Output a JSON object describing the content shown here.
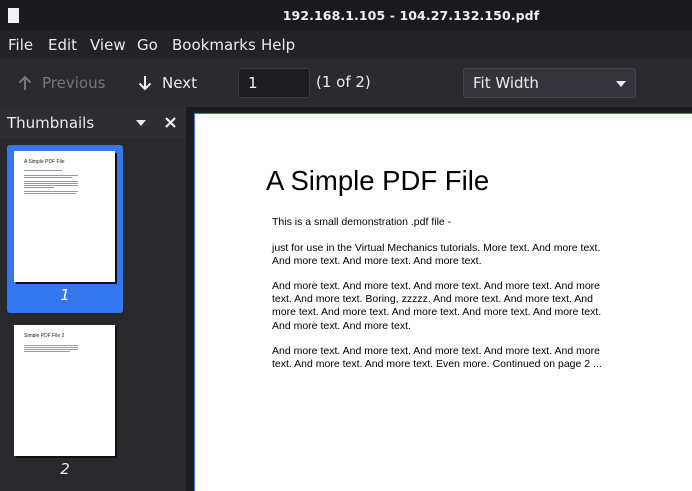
{
  "window": {
    "title": "192.168.1.105 - 104.27.132.150.pdf"
  },
  "menu": [
    "File",
    "Edit",
    "View",
    "Go",
    "Bookmarks",
    "Help"
  ],
  "toolbar": {
    "previous_label": "Previous",
    "next_label": "Next",
    "page_value": "1",
    "page_count": "(1 of 2)",
    "zoom_value": "Fit Width"
  },
  "sidebar": {
    "title": "Thumbnails",
    "thumbnails": [
      {
        "number": "1",
        "title": "A Simple PDF File",
        "selected": true
      },
      {
        "number": "2",
        "title": "Simple PDF File 2",
        "selected": false
      }
    ]
  },
  "document": {
    "title": "A Simple PDF File",
    "paragraphs": [
      "This is a small demonstration .pdf file -",
      "just for use in the Virtual Mechanics tutorials. More text. And more text. And more text. And more text. And more text.",
      "And more text. And more text. And more text. And more text. And more text. And more text. Boring, zzzzz. And more text. And more text. And more text. And more text. And more text. And more text. And more text. And more text. And more text.",
      "And more text. And more text. And more text. And more text. And more text. And more text. And more text. Even more. Continued on page 2 ..."
    ]
  },
  "colors": {
    "accent": "#3577ee",
    "toolbar_bg": "#2a2a2f",
    "page_bg": "#ffffff"
  }
}
